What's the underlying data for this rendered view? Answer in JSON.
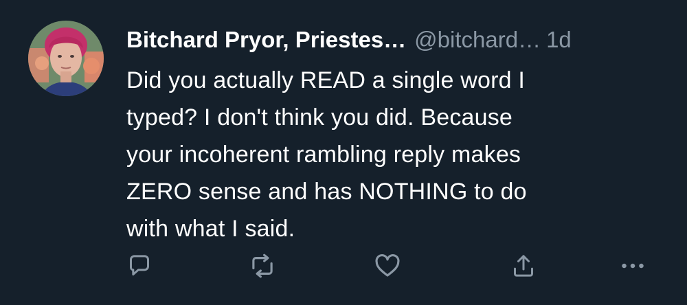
{
  "tweet": {
    "display_name": "Bitchard Pryor, Priestes…",
    "handle": "@bitchard…",
    "time": "1d",
    "lines": [
      "Did you actually READ a single word I",
      "typed? I don't think you did. Because",
      "your incoherent rambling reply makes",
      "ZERO sense and has NOTHING to do",
      "with what I said."
    ]
  },
  "actions": {
    "reply_icon": "reply-icon",
    "retweet_icon": "retweet-icon",
    "like_icon": "heart-icon",
    "share_icon": "share-icon",
    "more_icon": "more-icon"
  },
  "colors": {
    "background": "#15202b",
    "text": "#ffffff",
    "secondary": "#8b98a5",
    "icon": "#8b98a5"
  }
}
